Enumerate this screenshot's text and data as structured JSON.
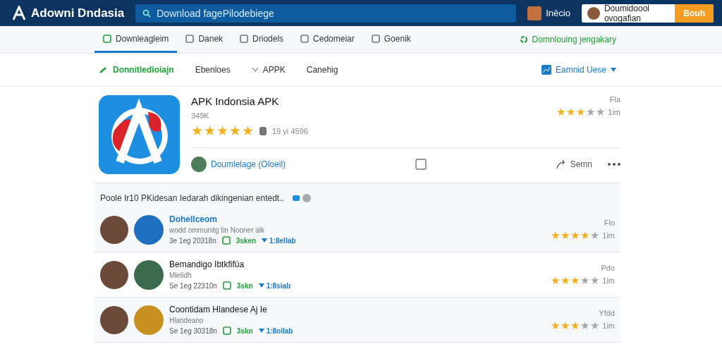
{
  "header": {
    "logo": "Adowni Dndasia",
    "search_value": "Download fagePilodebiege",
    "user": "Inēcio",
    "field_value": "Doumidoool ovogafian",
    "button": "Bouh"
  },
  "tabs": [
    {
      "label": "Downleagleim",
      "selected": true
    },
    {
      "label": "Danek",
      "selected": false
    },
    {
      "label": "Driodels",
      "selected": false
    },
    {
      "label": "Cedomeiar",
      "selected": false
    },
    {
      "label": "Goenik",
      "selected": false
    }
  ],
  "tabs_link": "Domnlouing jengakary",
  "filters": {
    "link": "Donnitledioiajn",
    "items": [
      "Ebenloes",
      "APPK",
      "Canehig"
    ],
    "sort": "Eamnid Uese"
  },
  "app": {
    "title": "APK Indonsia APK",
    "size": "349K",
    "stars": 5,
    "meta": "19 yi 4596",
    "side": {
      "tag": "Fla",
      "stars": 3,
      "time": "1im"
    },
    "action": "Doumlelage (Oloeil)",
    "share": "Semn"
  },
  "reviews_title": "Poole Ir10 PKidesan Iedarah dikingenian entedt..",
  "reviews": [
    {
      "name": "Dohellceom",
      "sub": "wodd ommunitg tin Nooner alk",
      "date": "3e 1eg 20318n",
      "likes": "3sken",
      "replies": "1:8ellab",
      "tag": "Flo",
      "stars": 4,
      "time": "1im"
    },
    {
      "name": "Bemandigo Ibtkfifüa",
      "sub": "Mlelidh",
      "date": "Se 1eg 22310n",
      "likes": "3skn",
      "replies": "1:8siab",
      "tag": "Pdo",
      "stars": 3,
      "time": "1im"
    },
    {
      "name": "Coontidam Hlandese Aj Ie",
      "sub": "Hlandeano",
      "date": "Se 1eg 30318n",
      "likes": "3skn",
      "replies": "1:8oilab",
      "tag": "Yfdd",
      "stars": 3,
      "time": "1im"
    }
  ]
}
